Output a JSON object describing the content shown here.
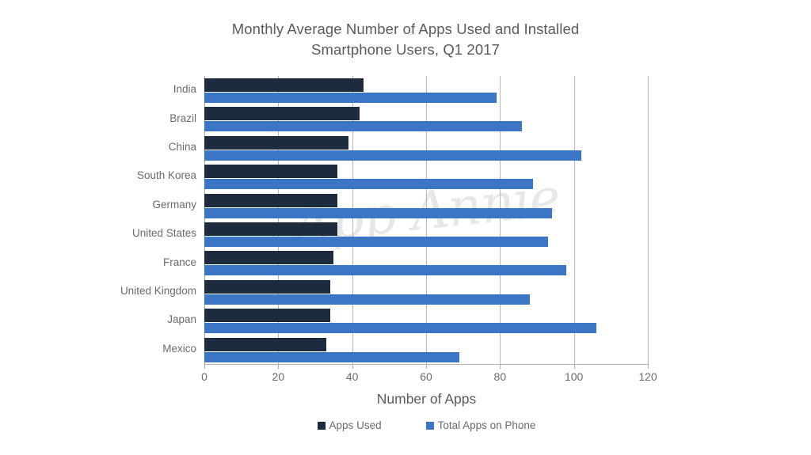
{
  "chart_data": {
    "type": "bar",
    "orientation": "horizontal",
    "title": "Monthly Average Number of Apps Used and Installed\nSmartphone Users, Q1 2017",
    "title_line1": "Monthly Average Number of Apps Used and Installed",
    "title_line2": "Smartphone Users, Q1 2017",
    "xlabel": "Number of Apps",
    "ylabel": "",
    "xlim": [
      0,
      120
    ],
    "xticks": [
      0,
      20,
      40,
      60,
      80,
      100,
      120
    ],
    "xtick_labels": [
      "0",
      "20",
      "40",
      "60",
      "80",
      "100",
      "120"
    ],
    "grid": true,
    "grid_axis": "x",
    "legend_position": "bottom",
    "categories": [
      "India",
      "Brazil",
      "China",
      "South Korea",
      "Germany",
      "United States",
      "France",
      "United Kingdom",
      "Japan",
      "Mexico"
    ],
    "series": [
      {
        "name": "Apps Used",
        "color": "#1d2b3f",
        "values": [
          43,
          42,
          39,
          36,
          36,
          36,
          35,
          34,
          34,
          33
        ]
      },
      {
        "name": "Total Apps on Phone",
        "color": "#3a76c4",
        "values": [
          79,
          86,
          102,
          89,
          94,
          93,
          98,
          88,
          106,
          69
        ]
      }
    ],
    "watermark": "App Annie"
  },
  "colors": {
    "apps_used": "#1d2b3f",
    "total_apps": "#3a76c4",
    "gridline": "#b9b9b9",
    "text": "#6b6b6b",
    "title_text": "#5b5b5b",
    "background": "#ffffff"
  }
}
